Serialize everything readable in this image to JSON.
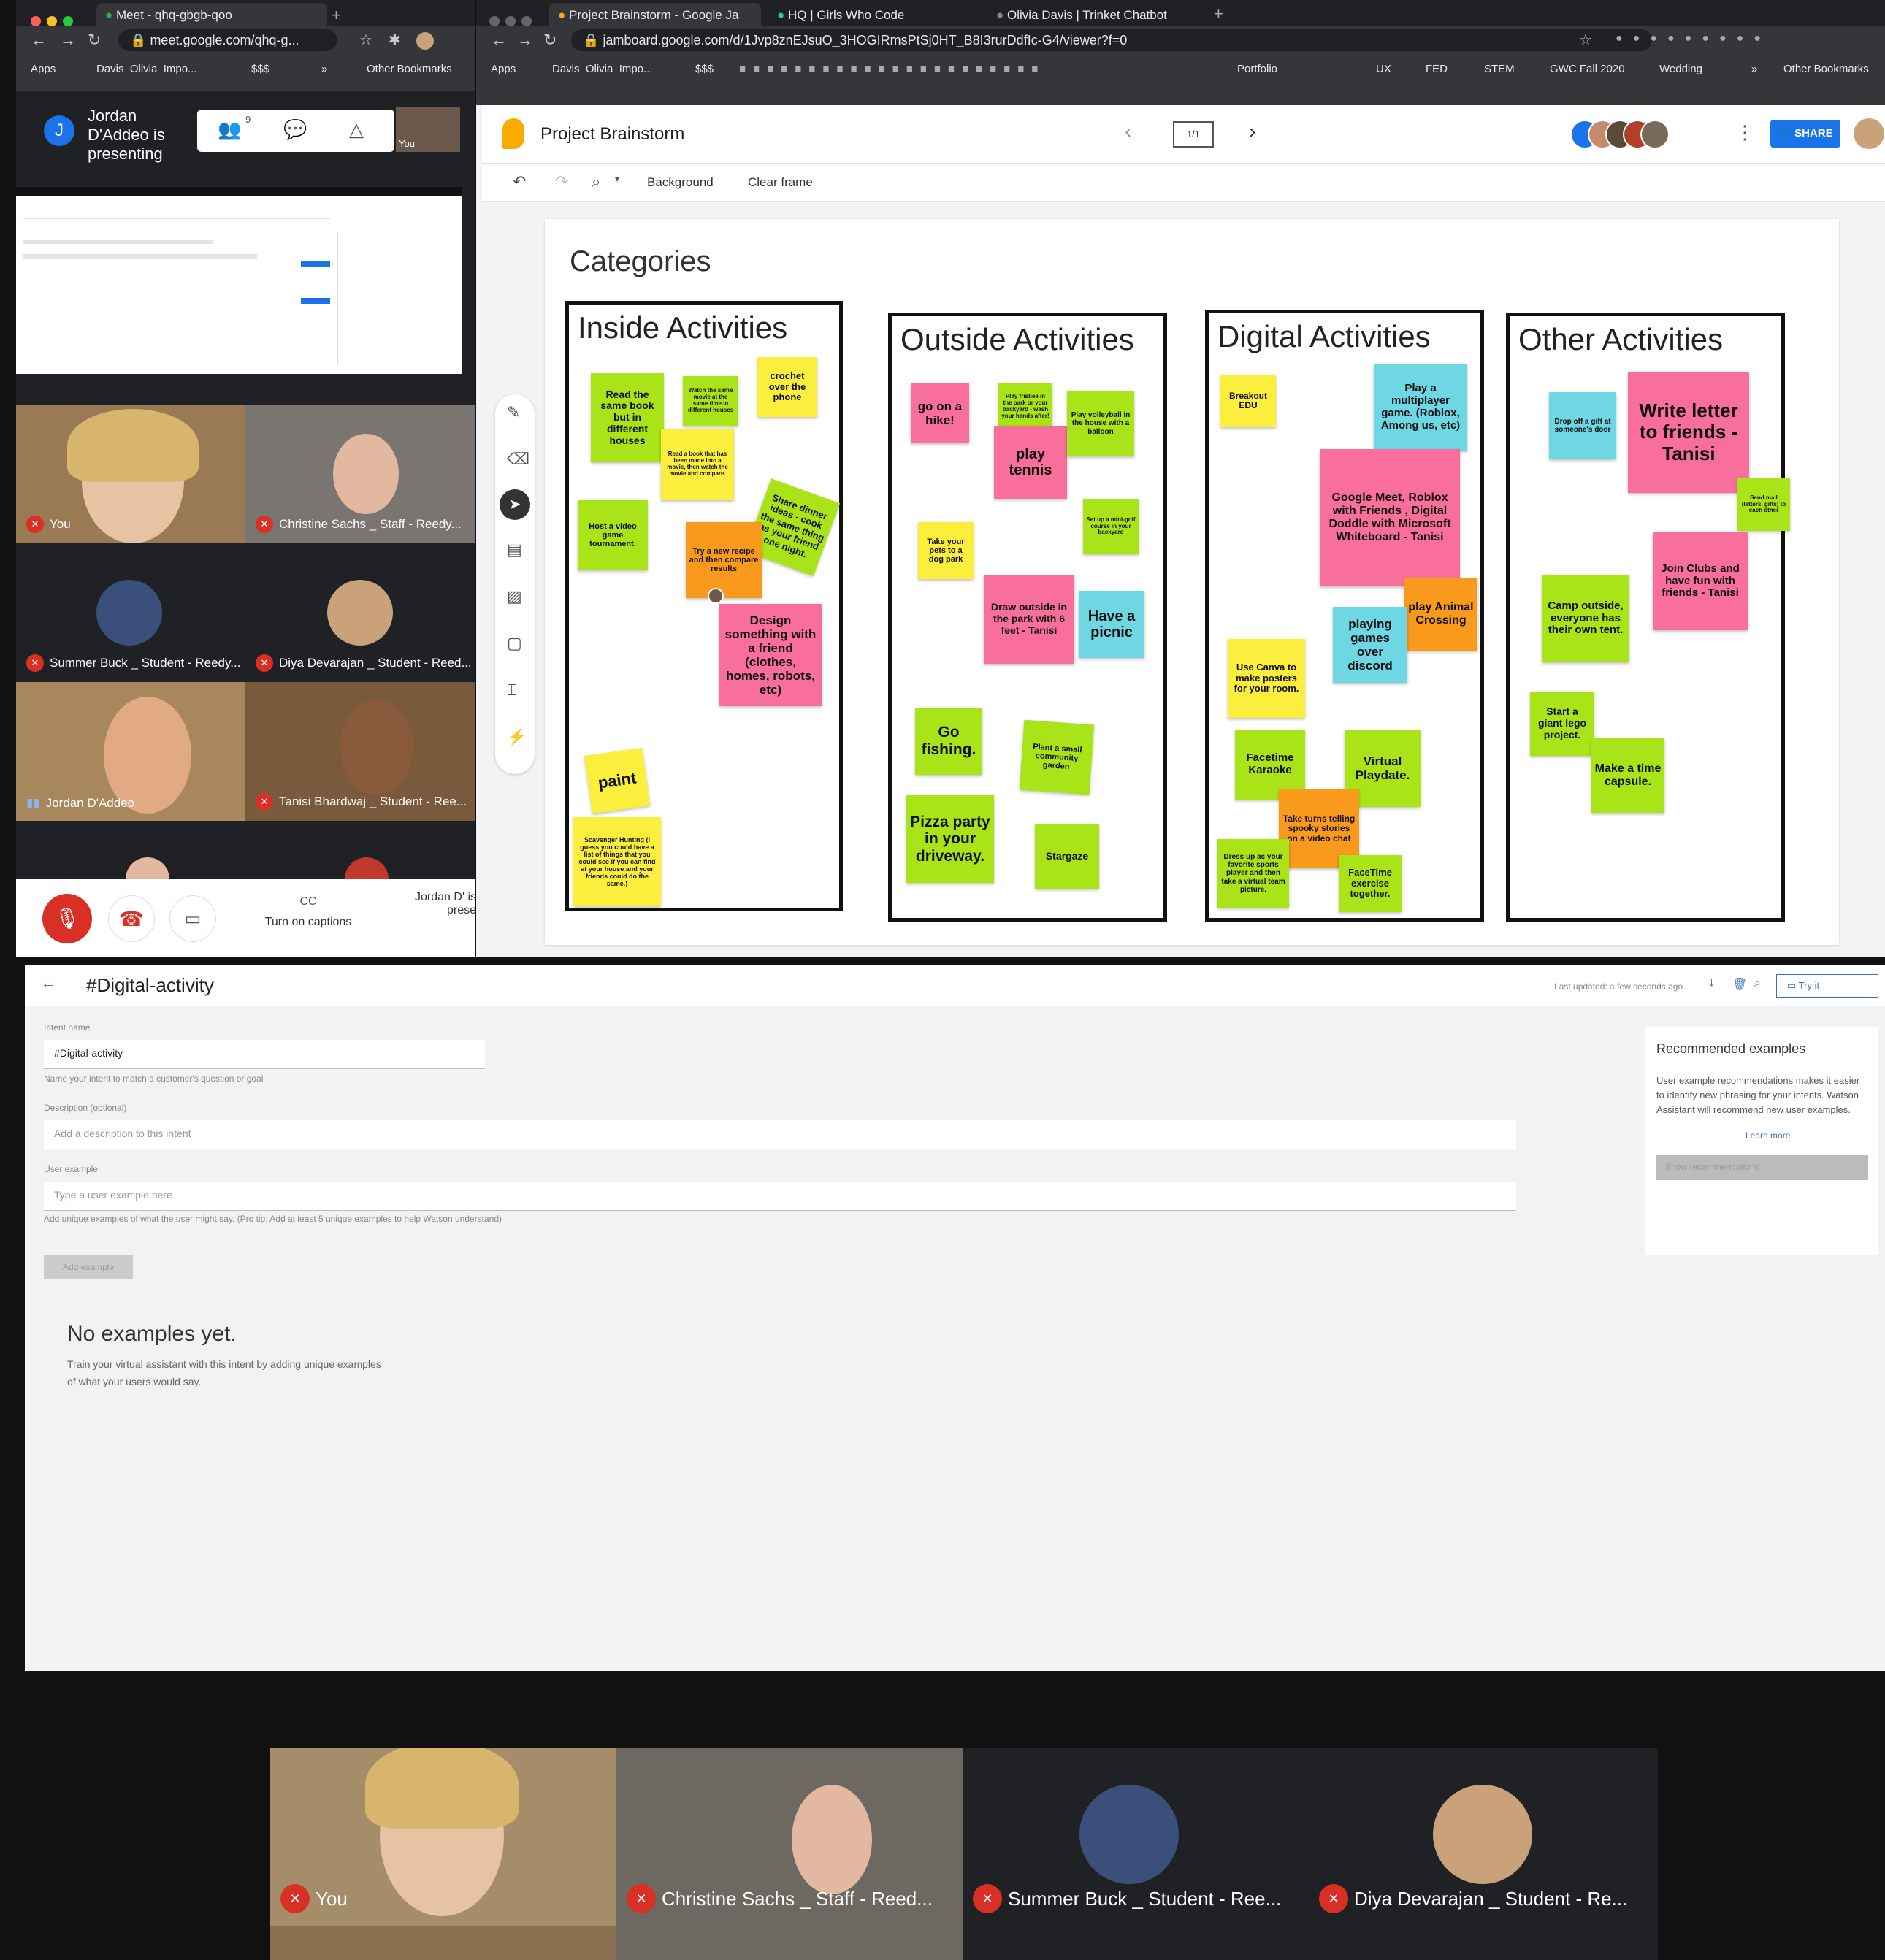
{
  "meet_window": {
    "tab_title": "Meet - qhq-gbgb-qoo",
    "url": "meet.google.com/qhq-g...",
    "bookmarks": [
      "Apps",
      "Davis_Olivia_Impo...",
      "$$$",
      "»",
      "Other Bookmarks"
    ],
    "presenter_initial": "J",
    "presenting_text": "Jordan D'Addeo is presenting",
    "people_count": "9",
    "you_label": "You",
    "participants": [
      {
        "name": "You"
      },
      {
        "name": "Christine Sachs _ Staff - Reedy..."
      },
      {
        "name": "Summer Buck _ Student - Reedy..."
      },
      {
        "name": "Diya Devarajan _ Student - Reed..."
      },
      {
        "name": "Jordan D'Addeo"
      },
      {
        "name": "Tanisi Bhardwaj _ Student - Ree..."
      }
    ],
    "captions_label": "Turn on captions",
    "presenting_short": "Jordan D' is prese"
  },
  "jam_window": {
    "tabs": [
      "Project Brainstorm - Google Ja",
      "HQ | Girls Who Code",
      "Olivia Davis | Trinket Chatbot"
    ],
    "url": "jamboard.google.com/d/1Jvp8znEJsuO_3HOGIRmsPtSj0HT_B8I3rurDdfIc-G4/viewer?f=0",
    "bookmarks": [
      "Apps",
      "Davis_Olivia_Impo...",
      "$$$",
      "Portfolio",
      "UX",
      "FED",
      "STEM",
      "GWC Fall 2020",
      "Wedding",
      "»",
      "Other Bookmarks"
    ],
    "title": "Project Brainstorm",
    "frame_counter": "1/1",
    "share_label": "SHARE",
    "toolbar": {
      "background": "Background",
      "clear": "Clear frame"
    },
    "board_title": "Categories",
    "columns": [
      {
        "title": "Inside Activities"
      },
      {
        "title": "Outside Activities"
      },
      {
        "title": "Digital Activities"
      },
      {
        "title": "Other Activities"
      }
    ],
    "notes": {
      "inside": [
        "Read the same book but in different houses",
        "Watch the same movie at the same time in different houses",
        "crochet over the phone",
        "Read a book that has been made into a movie, then watch the movie and compare.",
        "Share dinner ideas - cook the same thing as your friend one night.",
        "Host a video game tournament.",
        "Try a new recipe and then compare results",
        "Design something with a friend (clothes, homes, robots, etc)",
        "paint",
        "Scavenger Hunting (I guess you could have a list of things that you could see if you can find at your house and your friends could do the same.)"
      ],
      "outside": [
        "go on a hike!",
        "Play frisbee in the park or your backyard - wash your hands after!",
        "play tennis",
        "Play volleyball in the house with a balloon",
        "Take your pets to a dog park",
        "Set up a mini-golf course in your backyard",
        "Draw outside in the park with 6 feet - Tanisi",
        "Have a picnic",
        "Go fishing.",
        "Plant a small community garden",
        "Pizza party in your driveway.",
        "Stargaze"
      ],
      "digital": [
        "Breakout EDU",
        "Play a multiplayer game. (Roblox, Among us, etc)",
        "Google Meet, Roblox with Friends , Digital Doddle with Microsoft Whiteboard - Tanisi",
        "play Animal Crossing",
        "Use Canva to make posters for your room.",
        "playing games over discord",
        "Facetime Karaoke",
        "Virtual Playdate.",
        "Take turns telling spooky stories on a video chat",
        "Dress up as your favorite sports player and then take a virtual team picture.",
        "FaceTime exercise together."
      ],
      "other": [
        "Drop off a gift at someone's door",
        "Write letter to friends - Tanisi",
        "Send mail (letters, gifts) to each other",
        "Join Clubs and have fun with friends - Tanisi",
        "Camp outside, everyone has their own tent.",
        "Start a giant lego project.",
        "Make a time capsule."
      ]
    }
  },
  "watson": {
    "title": "#Digital-activity",
    "last_updated": "Last updated: a few seconds ago",
    "try_it": "Try it",
    "intent_label": "Intent name",
    "intent_value": "#Digital-activity",
    "intent_help": "Name your intent to match a customer's question or goal",
    "desc_label": "Description (optional)",
    "desc_placeholder": "Add a description to this intent",
    "example_label": "User example",
    "example_placeholder": "Type a user example here",
    "example_help": "Add unique examples of what the user might say. (Pro tip: Add at least 5 unique examples to help Watson understand)",
    "add_example": "Add example",
    "empty_title": "No examples yet.",
    "empty_text": "Train your virtual assistant with this intent by adding unique examples of what your users would say.",
    "rec_title": "Recommended examples",
    "rec_text": "User example recommendations makes it easier to identify new phrasing for your intents. Watson Assistant will recommend new user examples.",
    "learn_more": "Learn more",
    "show_rec": "Show recommendations"
  },
  "bottom_strip": {
    "participants": [
      {
        "name": "You"
      },
      {
        "name": "Christine Sachs _ Staff - Reed..."
      },
      {
        "name": "Summer Buck _ Student - Ree..."
      },
      {
        "name": "Diya Devarajan _ Student - Re..."
      }
    ]
  },
  "colors": {
    "mic_off": "#d93025",
    "share_blue": "#1a73e8",
    "jam_yellow": "#f9ab00"
  }
}
